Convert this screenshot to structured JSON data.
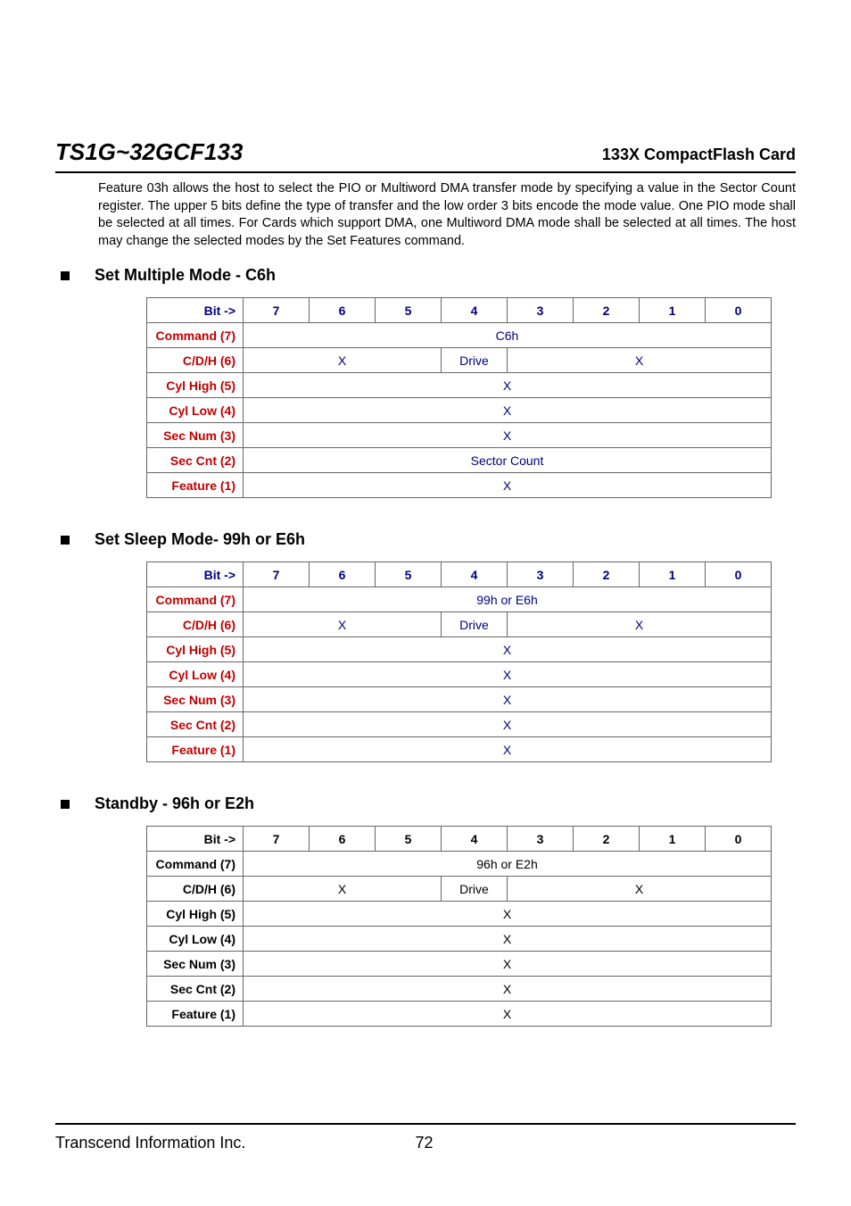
{
  "header": {
    "left": "TS1G~32GCF133",
    "right": "133X CompactFlash Card"
  },
  "intro": "Feature 03h allows the host to select the PIO or Multiword DMA transfer mode by specifying a value in the Sector Count register. The upper 5 bits define the type of transfer and the low order 3 bits encode the mode value. One PIO mode shall be selected at all times. For Cards which support DMA, one Multiword DMA mode shall be selected at all times. The host may change the selected modes by the Set Features command.",
  "sections": [
    {
      "title": "Set Multiple Mode - C6h"
    },
    {
      "title": "Set Sleep Mode- 99h or E6h"
    },
    {
      "title": "Standby - 96h or E2h"
    }
  ],
  "bit_header": {
    "label": "Bit ->",
    "cols": [
      "7",
      "6",
      "5",
      "4",
      "3",
      "2",
      "1",
      "0"
    ]
  },
  "labels": {
    "command": "Command (7)",
    "cdh": "C/D/H (6)",
    "cylhigh": "Cyl High (5)",
    "cyllow": "Cyl Low (4)",
    "secnum": "Sec Num (3)",
    "seccnt": "Sec Cnt (2)",
    "feature": "Feature (1)"
  },
  "cells": {
    "c6h": "C6h",
    "e99": "99h or E6h",
    "e96": "96h or E2h",
    "x": "X",
    "drive": "Drive",
    "sector_count": "Sector Count"
  },
  "footer": {
    "company": "Transcend Information Inc.",
    "page": "72"
  }
}
